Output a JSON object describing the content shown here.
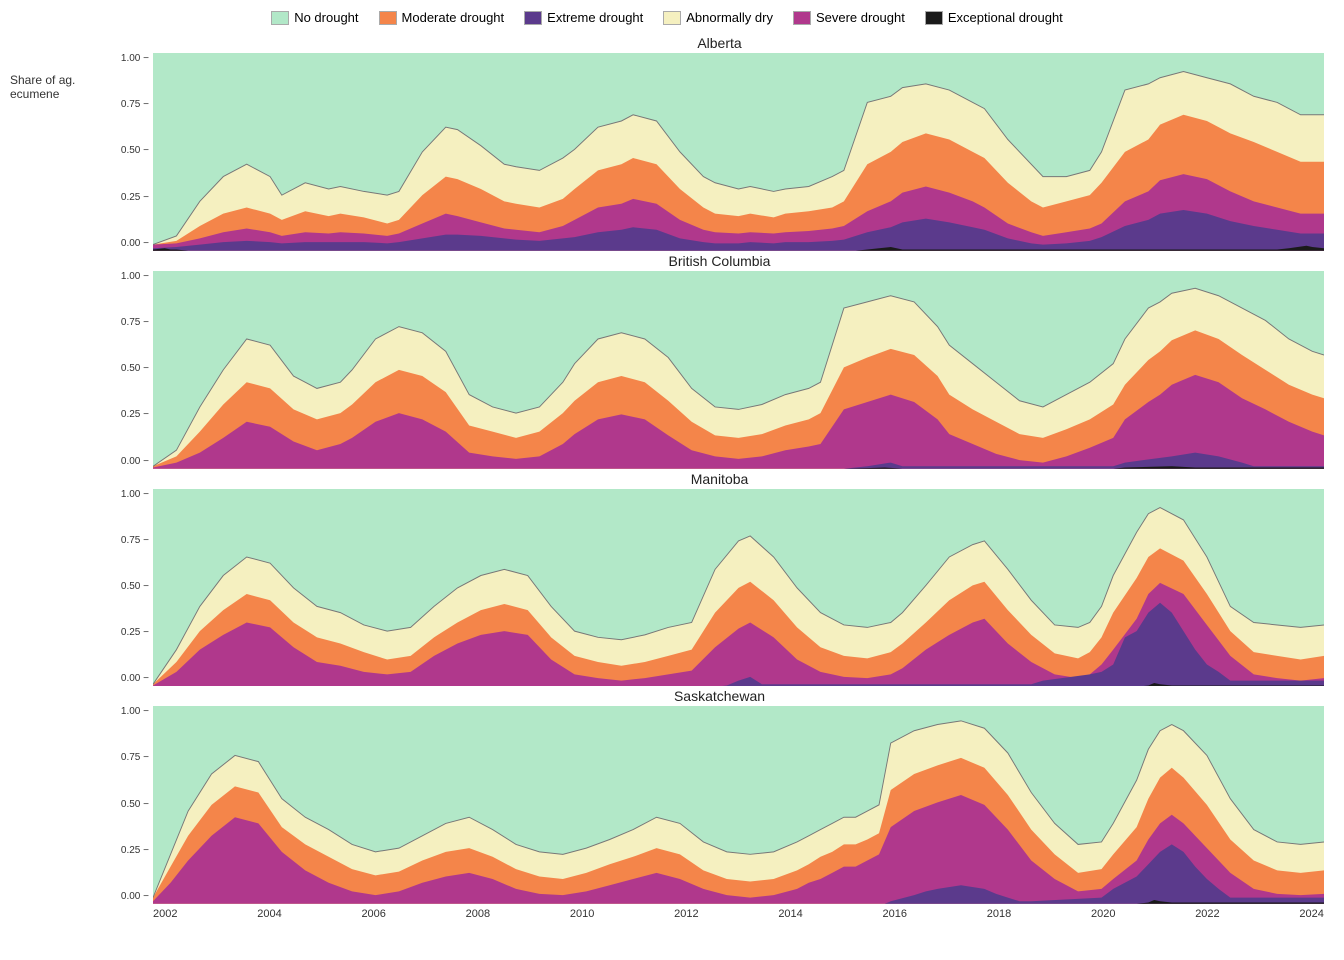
{
  "legend": {
    "items": [
      {
        "label": "No drought",
        "color": "#b2e8c8",
        "border": "#999"
      },
      {
        "label": "Moderate drought",
        "color": "#f4854a",
        "border": "#999"
      },
      {
        "label": "Extreme drought",
        "color": "#5b3a8c",
        "border": "#999"
      },
      {
        "label": "Abnormally dry",
        "color": "#f5f0c0",
        "border": "#999"
      },
      {
        "label": "Severe drought",
        "color": "#b0388c",
        "border": "#999"
      },
      {
        "label": "Exceptional drought",
        "color": "#1a1a1a",
        "border": "#999"
      }
    ]
  },
  "yAxisLabel": "Share of ag. ecumene",
  "yTicks": [
    "1.00 -",
    "0.75 -",
    "0.50 -",
    "0.25 -",
    "0.00 -"
  ],
  "xTicks": [
    "2002",
    "2004",
    "2006",
    "2008",
    "2010",
    "2012",
    "2014",
    "2016",
    "2018",
    "2020",
    "2022",
    "2024"
  ],
  "charts": [
    {
      "title": "Alberta"
    },
    {
      "title": "British Columbia"
    },
    {
      "title": "Manitoba"
    },
    {
      "title": "Saskatchewan"
    }
  ]
}
